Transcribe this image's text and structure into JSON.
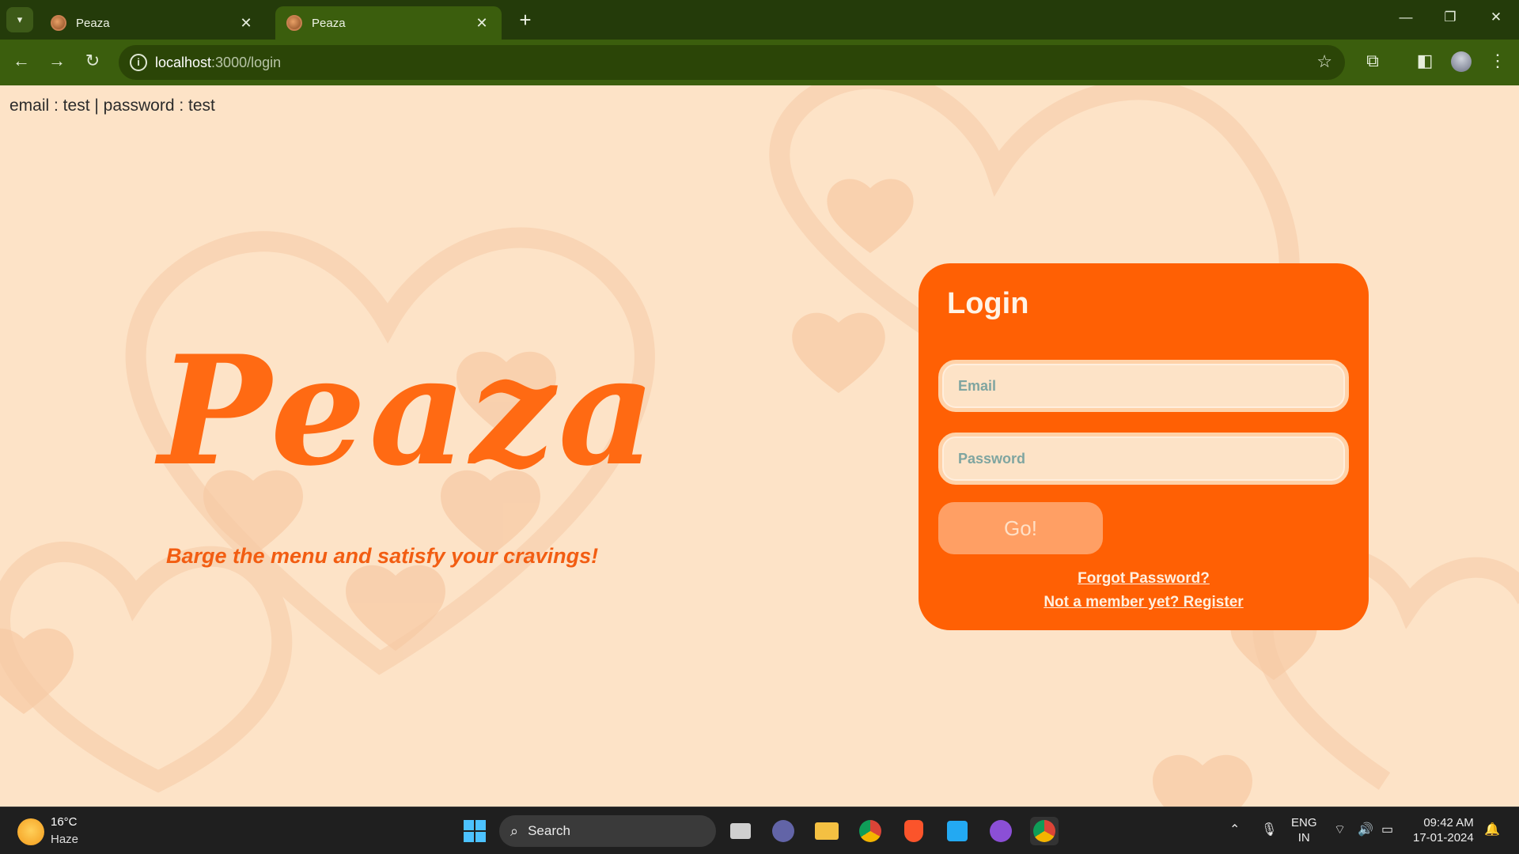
{
  "browser": {
    "tabs": [
      {
        "title": "Peaza",
        "close": "✕"
      },
      {
        "title": "Peaza",
        "close": "✕"
      }
    ],
    "new_tab": "+",
    "url_host": "localhost",
    "url_path": ":3000/login"
  },
  "page": {
    "hint": "email : test | password : test",
    "logo": "Peaza",
    "tagline": "Barge the menu and satisfy your cravings!",
    "login": {
      "title": "Login",
      "email_placeholder": "Email",
      "password_placeholder": "Password",
      "submit_label": "Go!",
      "forgot_link": "Forgot Password?",
      "register_link": "Not a member yet? Register"
    }
  },
  "taskbar": {
    "weather": {
      "temp": "16°C",
      "condition": "Haze"
    },
    "search_label": "Search",
    "lang": {
      "line1": "ENG",
      "line2": "IN"
    },
    "clock": {
      "time": "09:42 AM",
      "date": "17-01-2024"
    }
  },
  "colors": {
    "accent": "#ff6004",
    "background": "#fde3c7",
    "chrome": "#3b5e0d"
  }
}
